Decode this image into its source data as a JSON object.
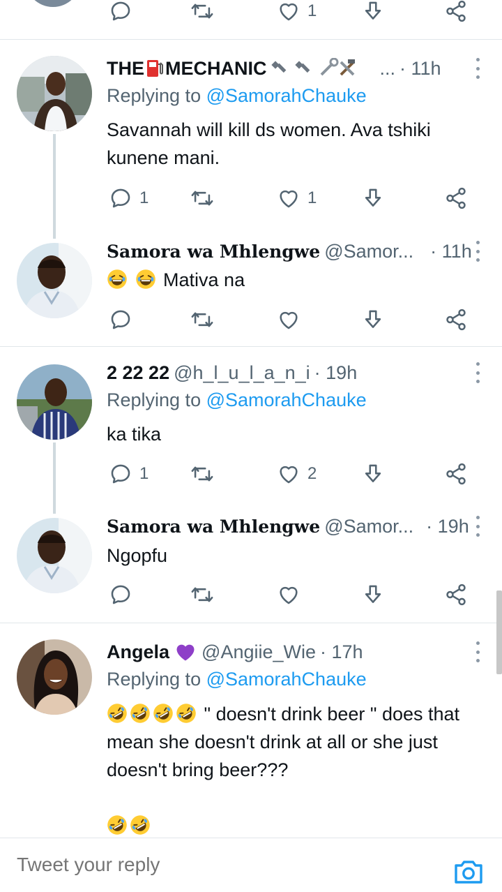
{
  "top_actions": {
    "likes": "1"
  },
  "tweets": [
    {
      "name": "THE",
      "name2": "MECHANIC",
      "name_tail": "...",
      "time": "· 11h",
      "replying_label": "Replying to ",
      "replying_handle": "@SamorahChauke",
      "text": "Savannah will kill ds women. Ava tshiki kunene mani.",
      "replies": "1",
      "likes": "1"
    },
    {
      "name": "Samora wa Mhlengwe",
      "handle": "@Samor...",
      "time": "· 11h",
      "text": "Mativa na",
      "replies": "",
      "likes": ""
    },
    {
      "name": "2 22 22",
      "handle": "@h_l_u_l_a_n_i",
      "time": "· 19h",
      "replying_label": "Replying to ",
      "replying_handle": "@SamorahChauke",
      "text": "ka tika",
      "replies": "1",
      "likes": "2"
    },
    {
      "name": "Samora wa Mhlengwe",
      "handle": "@Samor...",
      "time": "· 19h",
      "text": "Ngopfu",
      "replies": "",
      "likes": ""
    },
    {
      "name": "Angela",
      "handle": "@Angiie_Wie",
      "time": "· 17h",
      "replying_label": "Replying to ",
      "replying_handle": "@SamorahChauke",
      "text": " \" doesn't drink beer \" does that mean she doesn't drink at all or she just doesn't bring beer???"
    }
  ],
  "reply_bar": {
    "placeholder": "Tweet your reply"
  },
  "colors": {
    "link": "#1d9bf0",
    "muted": "#536471",
    "text": "#0f1419",
    "divider": "#e1e6ea"
  },
  "icons": [
    "reply-icon",
    "retweet-icon",
    "like-icon",
    "download-icon",
    "share-icon",
    "more-icon",
    "camera-icon",
    "laugh-emoji-icon",
    "rofl-emoji-icon",
    "purple-heart-icon",
    "fuel-pump-icon",
    "tool-icons"
  ]
}
